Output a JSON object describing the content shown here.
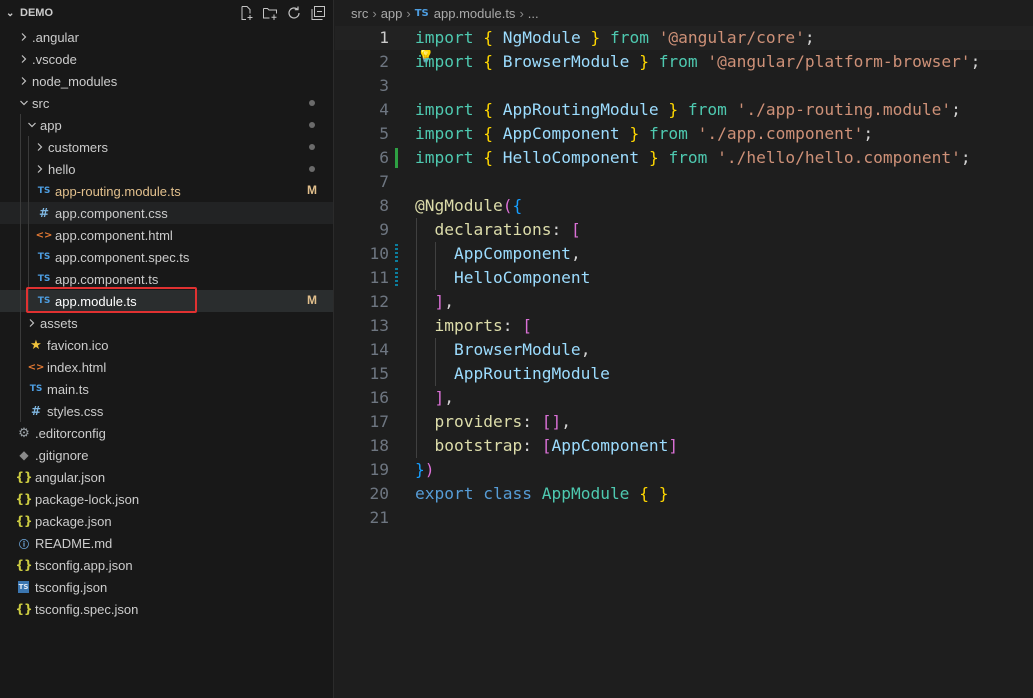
{
  "explorer": {
    "title": "DEMO",
    "actions": [
      "new-file-icon",
      "new-folder-icon",
      "refresh-icon",
      "collapse-all-icon"
    ],
    "items": [
      {
        "label": "angular",
        "prefix": ".",
        "type": "folder",
        "level": 1,
        "expanded": false
      },
      {
        "label": "vscode",
        "prefix": ".",
        "type": "folder",
        "level": 1,
        "expanded": false
      },
      {
        "label": "node_modules",
        "type": "folder",
        "level": 1,
        "expanded": false
      },
      {
        "label": "src",
        "type": "folder",
        "level": 1,
        "expanded": true,
        "status": "dot"
      },
      {
        "label": "app",
        "type": "folder",
        "level": 2,
        "expanded": true,
        "status": "dot"
      },
      {
        "label": "customers",
        "type": "folder",
        "level": 3,
        "expanded": false,
        "status": "dot"
      },
      {
        "label": "hello",
        "type": "folder",
        "level": 3,
        "expanded": false,
        "status": "dot"
      },
      {
        "label": "app-routing.module.ts",
        "type": "ts",
        "level": 3,
        "status": "M",
        "modified": true
      },
      {
        "label": "app.component.css",
        "type": "css",
        "level": 3,
        "hover": true
      },
      {
        "label": "app.component.html",
        "type": "html",
        "level": 3
      },
      {
        "label": "app.component.spec.ts",
        "type": "ts",
        "level": 3
      },
      {
        "label": "app.component.ts",
        "type": "ts",
        "level": 3
      },
      {
        "label": "app.module.ts",
        "type": "ts",
        "level": 3,
        "status": "M",
        "selected": true
      },
      {
        "label": "assets",
        "type": "folder",
        "level": 2,
        "expanded": false
      },
      {
        "label": "favicon.ico",
        "type": "star",
        "level": 2
      },
      {
        "label": "index.html",
        "type": "html",
        "level": 2
      },
      {
        "label": "main.ts",
        "type": "ts",
        "level": 2
      },
      {
        "label": "styles.css",
        "type": "css",
        "level": 2
      },
      {
        "label": "editorconfig",
        "prefix": ".",
        "type": "gear",
        "level": 1
      },
      {
        "label": "gitignore",
        "prefix": ".",
        "type": "git",
        "level": 1
      },
      {
        "label": "angular.json",
        "type": "json",
        "level": 1
      },
      {
        "label": "package-lock.json",
        "type": "json",
        "level": 1
      },
      {
        "label": "package.json",
        "type": "json",
        "level": 1
      },
      {
        "label": "README.md",
        "type": "info",
        "level": 1
      },
      {
        "label": "tsconfig.app.json",
        "type": "json",
        "level": 1
      },
      {
        "label": "tsconfig.json",
        "type": "tsjson",
        "level": 1
      },
      {
        "label": "tsconfig.spec.json",
        "type": "json",
        "level": 1
      }
    ],
    "icons": {
      "ts": "TS",
      "css": "#",
      "html": "<>",
      "json": "{}",
      "info": "ⓘ",
      "gear": "⚙",
      "star": "★",
      "git": "◆",
      "tsjson": "TS"
    }
  },
  "breadcrumb": {
    "parts": [
      "src",
      "app"
    ],
    "file_icon": "TS",
    "file": "app.module.ts",
    "tail": "..."
  },
  "editor": {
    "current_line": 1,
    "lines": [
      {
        "n": "1",
        "git": "",
        "tokens": [
          [
            "kw",
            "import"
          ],
          [
            "punc",
            " "
          ],
          [
            "brace",
            "{"
          ],
          [
            "punc",
            " "
          ],
          [
            "id",
            "NgModule"
          ],
          [
            "punc",
            " "
          ],
          [
            "brace",
            "}"
          ],
          [
            "punc",
            " "
          ],
          [
            "kw",
            "from"
          ],
          [
            "punc",
            " "
          ],
          [
            "str",
            "'@angular/core'"
          ],
          [
            "punc",
            ";"
          ]
        ]
      },
      {
        "n": "2",
        "git": "",
        "tokens": [
          [
            "kw",
            "import"
          ],
          [
            "punc",
            " "
          ],
          [
            "brace",
            "{"
          ],
          [
            "punc",
            " "
          ],
          [
            "id",
            "BrowserModule"
          ],
          [
            "punc",
            " "
          ],
          [
            "brace",
            "}"
          ],
          [
            "punc",
            " "
          ],
          [
            "kw",
            "from"
          ],
          [
            "punc",
            " "
          ],
          [
            "str",
            "'@angular/platform-browser'"
          ],
          [
            "punc",
            ";"
          ]
        ]
      },
      {
        "n": "3",
        "git": "",
        "tokens": []
      },
      {
        "n": "4",
        "git": "",
        "tokens": [
          [
            "kw",
            "import"
          ],
          [
            "punc",
            " "
          ],
          [
            "brace",
            "{"
          ],
          [
            "punc",
            " "
          ],
          [
            "id",
            "AppRoutingModule"
          ],
          [
            "punc",
            " "
          ],
          [
            "brace",
            "}"
          ],
          [
            "punc",
            " "
          ],
          [
            "kw",
            "from"
          ],
          [
            "punc",
            " "
          ],
          [
            "str",
            "'./app-routing.module'"
          ],
          [
            "punc",
            ";"
          ]
        ]
      },
      {
        "n": "5",
        "git": "",
        "tokens": [
          [
            "kw",
            "import"
          ],
          [
            "punc",
            " "
          ],
          [
            "brace",
            "{"
          ],
          [
            "punc",
            " "
          ],
          [
            "id",
            "AppComponent"
          ],
          [
            "punc",
            " "
          ],
          [
            "brace",
            "}"
          ],
          [
            "punc",
            " "
          ],
          [
            "kw",
            "from"
          ],
          [
            "punc",
            " "
          ],
          [
            "str",
            "'./app.component'"
          ],
          [
            "punc",
            ";"
          ]
        ]
      },
      {
        "n": "6",
        "git": "added",
        "tokens": [
          [
            "kw",
            "import"
          ],
          [
            "punc",
            " "
          ],
          [
            "brace",
            "{"
          ],
          [
            "punc",
            " "
          ],
          [
            "id",
            "HelloComponent"
          ],
          [
            "punc",
            " "
          ],
          [
            "brace",
            "}"
          ],
          [
            "punc",
            " "
          ],
          [
            "kw",
            "from"
          ],
          [
            "punc",
            " "
          ],
          [
            "str",
            "'./hello/hello.component'"
          ],
          [
            "punc",
            ";"
          ]
        ]
      },
      {
        "n": "7",
        "git": "",
        "tokens": []
      },
      {
        "n": "8",
        "git": "",
        "tokens": [
          [
            "deco",
            "@NgModule"
          ],
          [
            "bracket",
            "("
          ],
          [
            "bracket2",
            "{"
          ]
        ]
      },
      {
        "n": "9",
        "git": "",
        "tokens": [
          [
            "punc",
            "  "
          ],
          [
            "prop",
            "declarations"
          ],
          [
            "punc",
            ": "
          ],
          [
            "bracket",
            "["
          ]
        ]
      },
      {
        "n": "10",
        "git": "changed",
        "tokens": [
          [
            "punc",
            "    "
          ],
          [
            "id",
            "AppComponent"
          ],
          [
            "punc",
            ","
          ]
        ]
      },
      {
        "n": "11",
        "git": "changed",
        "tokens": [
          [
            "punc",
            "    "
          ],
          [
            "id",
            "HelloComponent"
          ]
        ]
      },
      {
        "n": "12",
        "git": "",
        "tokens": [
          [
            "punc",
            "  "
          ],
          [
            "bracket",
            "]"
          ],
          [
            "punc",
            ","
          ]
        ]
      },
      {
        "n": "13",
        "git": "",
        "tokens": [
          [
            "punc",
            "  "
          ],
          [
            "prop",
            "imports"
          ],
          [
            "punc",
            ": "
          ],
          [
            "bracket",
            "["
          ]
        ]
      },
      {
        "n": "14",
        "git": "",
        "tokens": [
          [
            "punc",
            "    "
          ],
          [
            "id",
            "BrowserModule"
          ],
          [
            "punc",
            ","
          ]
        ]
      },
      {
        "n": "15",
        "git": "",
        "tokens": [
          [
            "punc",
            "    "
          ],
          [
            "id",
            "AppRoutingModule"
          ]
        ]
      },
      {
        "n": "16",
        "git": "",
        "tokens": [
          [
            "punc",
            "  "
          ],
          [
            "bracket",
            "]"
          ],
          [
            "punc",
            ","
          ]
        ]
      },
      {
        "n": "17",
        "git": "",
        "tokens": [
          [
            "punc",
            "  "
          ],
          [
            "prop",
            "providers"
          ],
          [
            "punc",
            ": "
          ],
          [
            "bracket",
            "[]"
          ],
          [
            "punc",
            ","
          ]
        ]
      },
      {
        "n": "18",
        "git": "",
        "tokens": [
          [
            "punc",
            "  "
          ],
          [
            "prop",
            "bootstrap"
          ],
          [
            "punc",
            ": "
          ],
          [
            "bracket",
            "["
          ],
          [
            "id",
            "AppComponent"
          ],
          [
            "bracket",
            "]"
          ]
        ]
      },
      {
        "n": "19",
        "git": "",
        "tokens": [
          [
            "bracket2",
            "}"
          ],
          [
            "bracket",
            ")"
          ]
        ]
      },
      {
        "n": "20",
        "git": "",
        "tokens": [
          [
            "kw2",
            "export"
          ],
          [
            "punc",
            " "
          ],
          [
            "kw2",
            "class"
          ],
          [
            "punc",
            " "
          ],
          [
            "cls",
            "AppModule"
          ],
          [
            "punc",
            " "
          ],
          [
            "brace",
            "{"
          ],
          [
            "punc",
            " "
          ],
          [
            "brace",
            "}"
          ]
        ]
      },
      {
        "n": "21",
        "git": "",
        "tokens": []
      }
    ]
  }
}
